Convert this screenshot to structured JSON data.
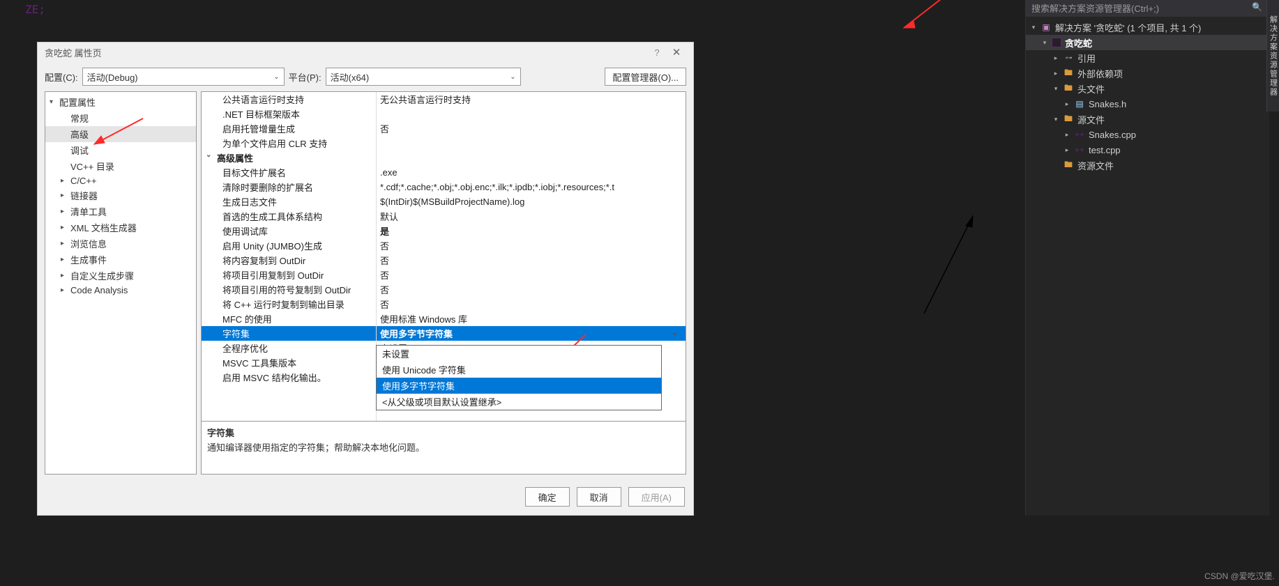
{
  "code_fragment": "ZE;",
  "dialog": {
    "title": "贪吃蛇 属性页",
    "help": "?",
    "close": "✕",
    "config_label": "配置(C):",
    "config_value": "活动(Debug)",
    "platform_label": "平台(P):",
    "platform_value": "活动(x64)",
    "config_mgr": "配置管理器(O)...",
    "ok": "确定",
    "cancel": "取消",
    "apply": "应用(A)"
  },
  "tree": [
    {
      "label": "配置属性",
      "indent": 0,
      "arrow": "▾"
    },
    {
      "label": "常规",
      "indent": 1
    },
    {
      "label": "高级",
      "indent": 1,
      "selected": true
    },
    {
      "label": "调试",
      "indent": 1
    },
    {
      "label": "VC++ 目录",
      "indent": 1
    },
    {
      "label": "C/C++",
      "indent": 1,
      "arrow": "▸"
    },
    {
      "label": "链接器",
      "indent": 1,
      "arrow": "▸"
    },
    {
      "label": "清单工具",
      "indent": 1,
      "arrow": "▸"
    },
    {
      "label": "XML 文档生成器",
      "indent": 1,
      "arrow": "▸"
    },
    {
      "label": "浏览信息",
      "indent": 1,
      "arrow": "▸"
    },
    {
      "label": "生成事件",
      "indent": 1,
      "arrow": "▸"
    },
    {
      "label": "自定义生成步骤",
      "indent": 1,
      "arrow": "▸"
    },
    {
      "label": "Code Analysis",
      "indent": 1,
      "arrow": "▸"
    }
  ],
  "grid": [
    {
      "label": "公共语言运行时支持",
      "value": "无公共语言运行时支持",
      "child": true
    },
    {
      "label": ".NET 目标框架版本",
      "value": "",
      "child": true
    },
    {
      "label": "启用托管增量生成",
      "value": "否",
      "child": true
    },
    {
      "label": "为单个文件启用 CLR 支持",
      "value": "",
      "child": true
    },
    {
      "label": "高级属性",
      "section": true,
      "arrow": "⌄"
    },
    {
      "label": "目标文件扩展名",
      "value": ".exe",
      "child": true
    },
    {
      "label": "清除时要删除的扩展名",
      "value": "*.cdf;*.cache;*.obj;*.obj.enc;*.ilk;*.ipdb;*.iobj;*.resources;*.t",
      "child": true
    },
    {
      "label": "生成日志文件",
      "value": "$(IntDir)$(MSBuildProjectName).log",
      "child": true
    },
    {
      "label": "首选的生成工具体系结构",
      "value": "默认",
      "child": true
    },
    {
      "label": "使用调试库",
      "value": "是",
      "child": true,
      "bold": true
    },
    {
      "label": "启用 Unity (JUMBO)生成",
      "value": "否",
      "child": true
    },
    {
      "label": "将内容复制到 OutDir",
      "value": "否",
      "child": true
    },
    {
      "label": "将项目引用复制到 OutDir",
      "value": "否",
      "child": true
    },
    {
      "label": "将项目引用的符号复制到 OutDir",
      "value": "否",
      "child": true
    },
    {
      "label": "将 C++ 运行时复制到输出目录",
      "value": "否",
      "child": true
    },
    {
      "label": "MFC 的使用",
      "value": "使用标准 Windows 库",
      "child": true
    },
    {
      "label": "字符集",
      "value": "使用多字节字符集",
      "child": true,
      "selected": true
    },
    {
      "label": "全程序优化",
      "value": "未设置",
      "child": true
    },
    {
      "label": "MSVC 工具集版本",
      "value": "使用 Unicode 字符集",
      "child": true
    },
    {
      "label": "启用 MSVC 结构化输出。",
      "value": "",
      "child": true
    }
  ],
  "dropdown": {
    "items": [
      "未设置",
      "使用 Unicode 字符集",
      "使用多字节字符集",
      "<从父级或项目默认设置继承>"
    ],
    "selected_index": 2
  },
  "desc": {
    "title": "字符集",
    "body": "通知编译器使用指定的字符集；帮助解决本地化问题。"
  },
  "solution": {
    "search_placeholder": "搜索解决方案资源管理器(Ctrl+;)",
    "items": [
      {
        "indent": 0,
        "arrow": "▾",
        "icon": "sol",
        "label": "解决方案 '贪吃蛇' (1 个项目, 共 1 个)"
      },
      {
        "indent": 1,
        "arrow": "▾",
        "icon": "proj",
        "label": "贪吃蛇",
        "selected": true,
        "bold": true
      },
      {
        "indent": 2,
        "arrow": "▸",
        "icon": "ref",
        "label": "引用"
      },
      {
        "indent": 2,
        "arrow": "▸",
        "icon": "folder",
        "label": "外部依赖项"
      },
      {
        "indent": 2,
        "arrow": "▾",
        "icon": "folder",
        "label": "头文件"
      },
      {
        "indent": 3,
        "arrow": "▸",
        "icon": "hfile",
        "label": "Snakes.h"
      },
      {
        "indent": 2,
        "arrow": "▾",
        "icon": "folder",
        "label": "源文件"
      },
      {
        "indent": 3,
        "arrow": "▸",
        "icon": "cppfile",
        "label": "Snakes.cpp"
      },
      {
        "indent": 3,
        "arrow": "▸",
        "icon": "cppfile",
        "label": "test.cpp"
      },
      {
        "indent": 2,
        "arrow": "",
        "icon": "folder",
        "label": "资源文件"
      }
    ]
  },
  "side_tab": "解决方案资源管理器",
  "watermark": "CSDN @爱吃汉堡."
}
